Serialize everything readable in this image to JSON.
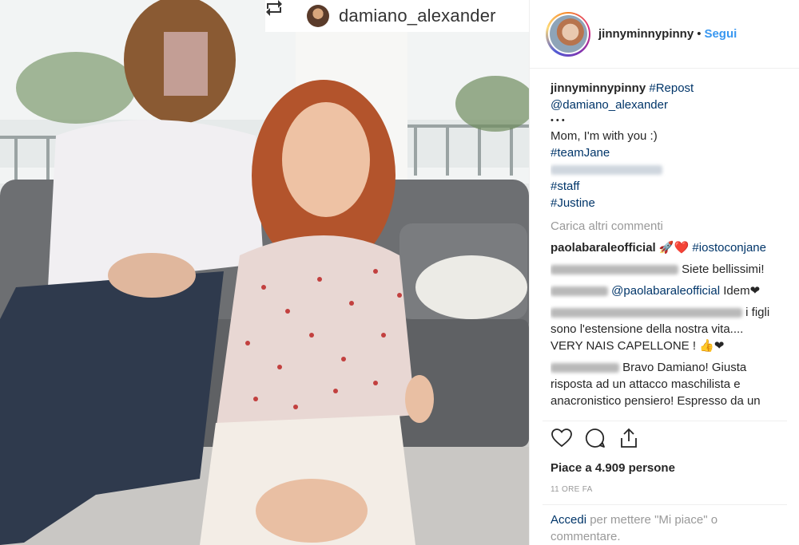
{
  "photo": {
    "repost_username": "damiano_alexander"
  },
  "header": {
    "username": "jinnyminnypinny",
    "separator": "•",
    "follow_label": "Segui"
  },
  "caption": {
    "username": "jinnyminnypinny",
    "hashtag_repost": "#Repost",
    "mention": "@damiano_alexander",
    "dots": "• • •",
    "text": "Mom, I'm with you :)",
    "hashtag_1": "#teamJane",
    "hashtag_3": "#staff",
    "hashtag_4": "#Justine"
  },
  "load_more": "Carica altri commenti",
  "comments": [
    {
      "username": "paolabaraleofficial",
      "emoji": "🚀❤️",
      "text": "#iostoconjane"
    },
    {
      "text": "Siete bellissimi!"
    },
    {
      "mention": "@paolabaraleofficial",
      "text": "Idem❤"
    },
    {
      "text_1": "i figli",
      "text_2": "sono l'estensione della nostra vita....",
      "text_3": "VERY NAIS CAPELLONE ! 👍❤"
    },
    {
      "text_1": "Bravo Damiano! Giusta",
      "text_2": "risposta ad un attacco maschilista e",
      "text_3": "anacronistico pensiero! Espresso da un"
    }
  ],
  "actions": {
    "like_icon": "heart-outline-icon",
    "comment_icon": "speech-bubble-icon",
    "share_icon": "share-upload-icon"
  },
  "likes_text": "Piace a 4.909 persone",
  "timestamp": "11 ORE FA",
  "login_prompt": {
    "link": "Accedi",
    "text": " per mettere \"Mi piace\" o commentare."
  }
}
